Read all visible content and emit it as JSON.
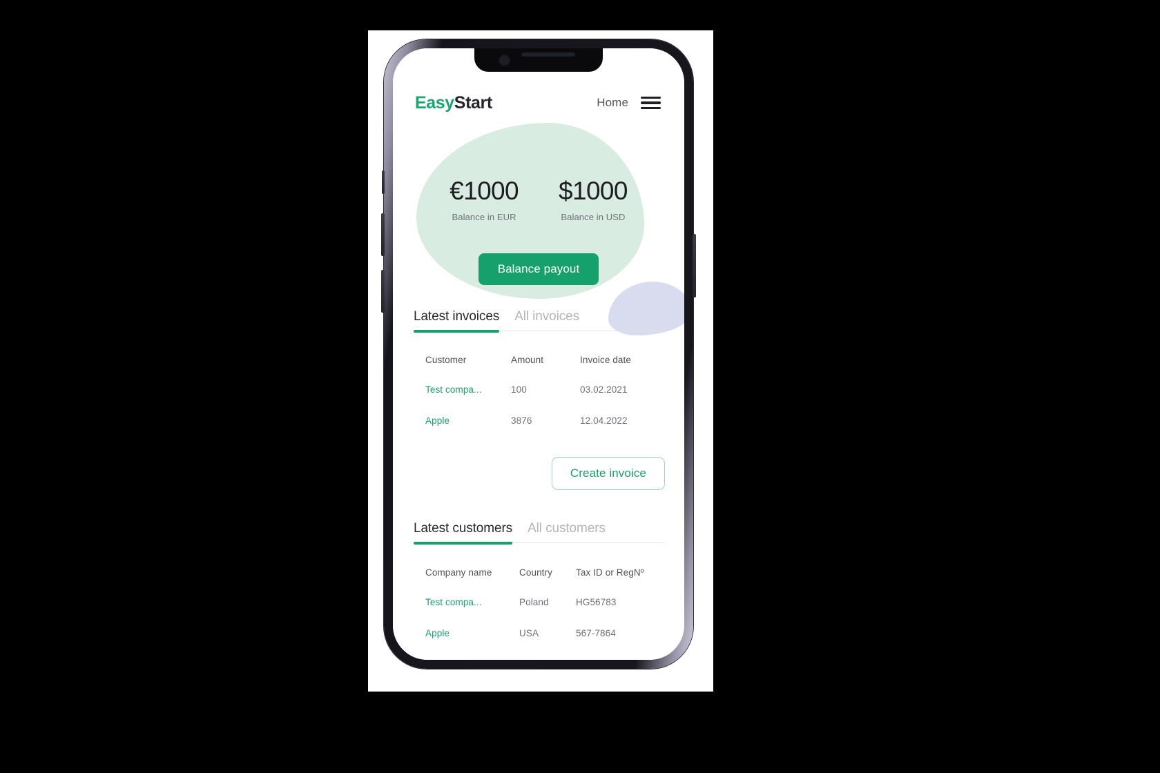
{
  "app": {
    "logo": {
      "part1": "Easy",
      "part2": "Start"
    },
    "nav": {
      "home": "Home",
      "menu_icon": "hamburger-menu-icon"
    },
    "colors": {
      "brand_green": "#16a06b",
      "link_green": "#19a06d",
      "blob_green": "#d8ece2",
      "blob_lavender": "#d9dcef",
      "text_dark": "#1d1e22",
      "text_muted": "#6d7076",
      "tab_inactive": "#b2b5ba"
    }
  },
  "balances": [
    {
      "amount": "€1000",
      "label": "Balance in EUR"
    },
    {
      "amount": "$1000",
      "label": "Balance in USD"
    }
  ],
  "payout": {
    "label": "Balance payout"
  },
  "invoices": {
    "tabs": [
      {
        "label": "Latest invoices",
        "active": true
      },
      {
        "label": "All invoices",
        "active": false
      }
    ],
    "headers": [
      "Customer",
      "Amount",
      "Invoice date"
    ],
    "rows": [
      {
        "customer": "Test compa...",
        "amount": "100",
        "date": "03.02.2021"
      },
      {
        "customer": "Apple",
        "amount": "3876",
        "date": "12.04.2022"
      }
    ],
    "create_button": "Create invoice"
  },
  "customers": {
    "tabs": [
      {
        "label": "Latest customers",
        "active": true
      },
      {
        "label": "All customers",
        "active": false
      }
    ],
    "headers": [
      "Company name",
      "Country",
      "Tax ID or RegNº"
    ],
    "rows": [
      {
        "company": "Test compa...",
        "country": "Poland",
        "taxid": "HG56783"
      },
      {
        "company": "Apple",
        "country": "USA",
        "taxid": "567-7864"
      }
    ]
  }
}
